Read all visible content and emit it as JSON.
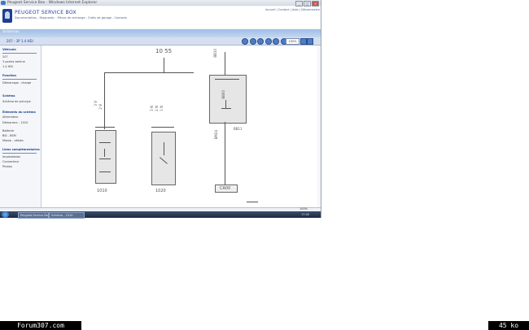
{
  "window": {
    "title": "Peugeot Service Box - Windows Internet Explorer",
    "controls": [
      "_",
      "□",
      "×"
    ]
  },
  "header": {
    "brand": "PEUGEOT SERVICE BOX",
    "subtitle": "Documentation - Diagnostic - Pièces de rechange - Outils de garage - Contacts",
    "top_links": "Accueil | Contact | Aide | Déconnexion"
  },
  "menu": {
    "tab": "Schémas"
  },
  "toolbar": {
    "label": "207 - 3P 1.4 HDi",
    "zoom": "100%"
  },
  "nav": {
    "vehicule_head": "Véhicule",
    "vehicule_lines": [
      "207",
      "3 portes berline",
      "1.4 HDi"
    ],
    "fonction_head": "Fonction",
    "fonction_lines": [
      "Démarrage - charge"
    ],
    "schema_head": "Schéma",
    "schema_lines": [
      "Schéma de principe"
    ],
    "elements_head": "Éléments du schéma",
    "elements_lines": [
      "Alternateur",
      "Démarreur - 1010",
      "Batterie",
      "BSI - BSM",
      "Masse - câbles"
    ],
    "hyperliens_head": "Liens complémentaires",
    "hyperliens_lines": [
      "Implantation",
      "Connecteur",
      "Photos"
    ]
  },
  "diagram": {
    "top_label": "10 55",
    "comp_a_code": "1010",
    "comp_b_code": "1020",
    "comp_c_label": "BB00",
    "comp_c_code": "CA00",
    "pin_labels": [
      "3 V",
      "2 V",
      "1 V",
      "3 N",
      "2 N",
      "1 N",
      "BB10",
      "BM34",
      "BB11"
    ]
  },
  "status": {
    "zoom": "100%"
  },
  "taskbar": {
    "items": [
      "Peugeot Service Box",
      "Schéma - 1010"
    ],
    "clock": "17:42"
  },
  "footer": {
    "left": "Forum307.com",
    "right": "45 ko"
  }
}
